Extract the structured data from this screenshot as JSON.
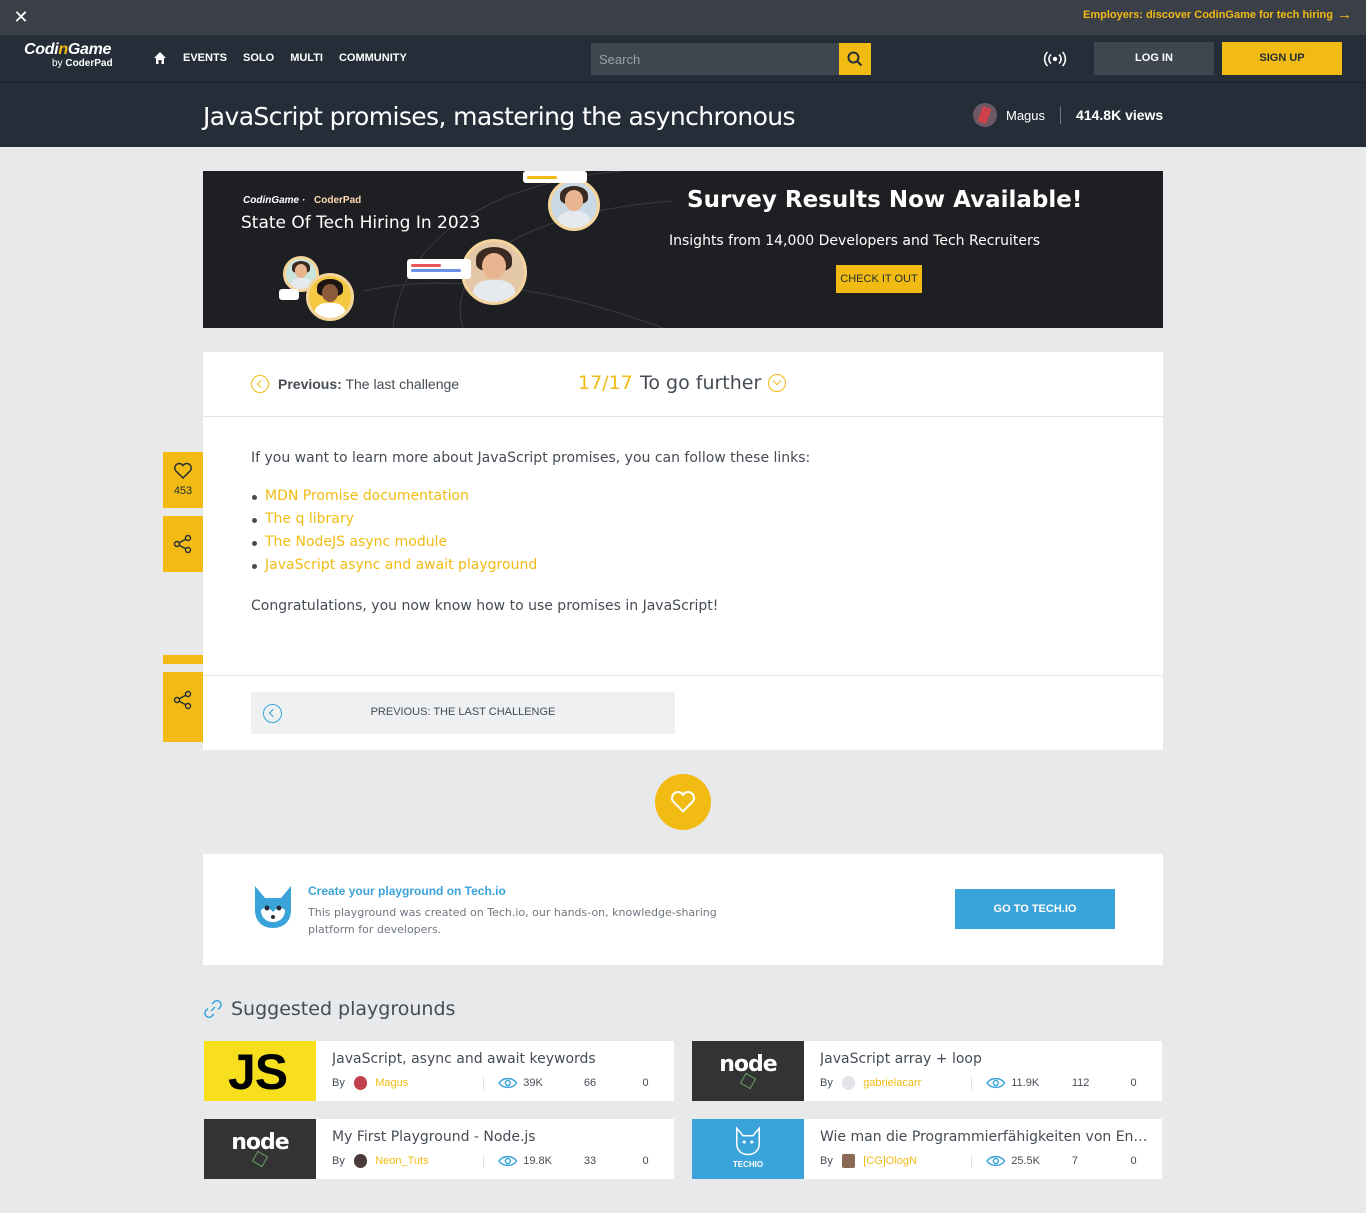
{
  "topbar": {
    "close_icon": "close-icon",
    "employers_text": "Employers: discover CodinGame for tech hiring",
    "employers_arrow": "→"
  },
  "nav": {
    "logo_main_a": "Codi",
    "logo_main_b": "n",
    "logo_main_c": "Game",
    "logo_by": "by ",
    "logo_coderpad": "CoderPad",
    "links": [
      "EVENTS",
      "SOLO",
      "MULTI",
      "COMMUNITY"
    ],
    "search_placeholder": "Search",
    "login": "LOG IN",
    "signup": "SIGN UP"
  },
  "title": {
    "text": "JavaScript promises, mastering the asynchronous",
    "author": "Magus",
    "views": "414.8K views"
  },
  "ad": {
    "brand_cg": "CodinGame",
    "brand_sep": "·",
    "brand_cp": "CoderPad",
    "hiring": "State Of Tech Hiring In 2023",
    "headline": "Survey Results Now Available!",
    "insight": "Insights from 14,000 Developers and Tech Recruiters",
    "cta": "CHECK IT OUT"
  },
  "lesson": {
    "prev_label": "Previous:",
    "prev_title": "The last challenge",
    "step": "17/17",
    "step_title": "To go further",
    "intro": "If you want to learn more about JavaScript promises, you can follow these links:",
    "links": [
      "MDN Promise documentation",
      "The q library",
      "The NodeJS async module",
      "JavaScript async and await playground"
    ],
    "outro": "Congratulations, you now know how to use promises in JavaScript!",
    "prev_button": "PREVIOUS: THE LAST CHALLENGE"
  },
  "side": {
    "likes": "453"
  },
  "techio": {
    "title": "Create your playground on Tech.io",
    "desc": "This playground was created on Tech.io, our hands-on, knowledge-sharing platform for developers.",
    "button": "GO TO TECH.IO"
  },
  "suggested": {
    "title": "Suggested playgrounds",
    "items": [
      {
        "name": "JavaScript, async and await keywords",
        "by": "By",
        "user": "Magus",
        "views": "39K",
        "likes": "66",
        "comments": "0",
        "thumb": "JS"
      },
      {
        "name": "JavaScript array + loop",
        "by": "By",
        "user": "gabrielacarr",
        "views": "11.9K",
        "likes": "112",
        "comments": "0",
        "thumb": "node"
      },
      {
        "name": "My First Playground - Node.js",
        "by": "By",
        "user": "Neon_Tuts",
        "views": "19.8K",
        "likes": "33",
        "comments": "0",
        "thumb": "node"
      },
      {
        "name": "Wie man die Programmierfähigkeiten von Entwicklern testet",
        "by": "By",
        "user": "[CG]OlogN",
        "views": "25.5K",
        "likes": "7",
        "comments": "0",
        "thumb": "TECHIO"
      }
    ]
  },
  "colors": {
    "accent": "#f2bb13",
    "dark": "#252e38",
    "techio": "#3aa3d9"
  }
}
